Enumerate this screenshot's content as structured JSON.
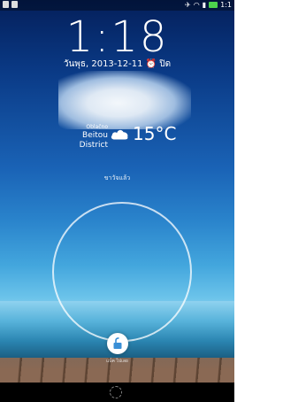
{
  "status_bar": {
    "right_text": "1:1"
  },
  "lockscreen": {
    "time": "1:18",
    "date": "วันพุธ, 2013-12-11",
    "alarm_label": "ปิด",
    "owner_message": "ขาวัจแล้ว",
    "unlock_hint": "แบ็ค ไปเลย",
    "weather": {
      "condition": "Oblačno",
      "location": "Beitou District",
      "temperature": "15°C",
      "icon": "cloud-icon"
    }
  }
}
